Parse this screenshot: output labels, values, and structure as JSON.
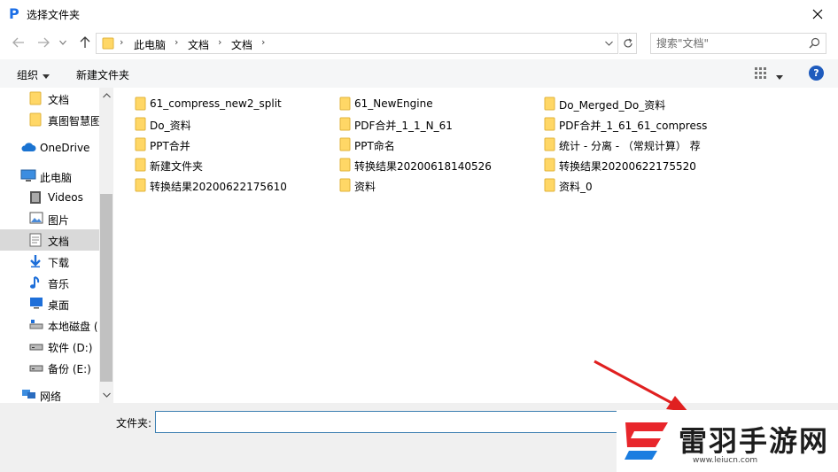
{
  "window": {
    "title": "选择文件夹",
    "app_icon_glyph": "P",
    "accent_color": "#1b6ee6"
  },
  "address_bar": {
    "breadcrumbs": [
      "此电脑",
      "文档",
      "文档"
    ],
    "separator": "›"
  },
  "search": {
    "placeholder": "搜索\"文档\""
  },
  "toolbar": {
    "organize_label": "组织",
    "new_folder_label": "新建文件夹",
    "help_label": "?"
  },
  "nav": {
    "items": [
      {
        "label": "文档",
        "icon": "folder-icon"
      },
      {
        "label": "真图智慧图",
        "icon": "folder-icon"
      },
      {
        "label": "OneDrive",
        "icon": "cloud-icon"
      },
      {
        "label": "此电脑",
        "icon": "computer-icon"
      },
      {
        "label": "Videos",
        "icon": "video-icon"
      },
      {
        "label": "图片",
        "icon": "pictures-icon"
      },
      {
        "label": "文档",
        "icon": "documents-icon"
      },
      {
        "label": "下载",
        "icon": "download-icon"
      },
      {
        "label": "音乐",
        "icon": "music-icon"
      },
      {
        "label": "桌面",
        "icon": "desktop-icon"
      },
      {
        "label": "本地磁盘 (",
        "icon": "drive-icon"
      },
      {
        "label": "软件 (D:)",
        "icon": "drive-icon"
      },
      {
        "label": "备份 (E:)",
        "icon": "drive-icon"
      },
      {
        "label": "网络",
        "icon": "network-icon"
      }
    ],
    "selected_index": 6
  },
  "files": [
    "61_compress_new2_split",
    "Do_资料",
    "PPT合并",
    "新建文件夹",
    "转换结果20200622175610",
    "61_NewEngine",
    "PDF合并_1_1_N_61",
    "PPT命名",
    "转换结果20200618140526",
    "资料",
    "Do_Merged_Do_资料",
    "PDF合并_1_61_61_compress",
    "统计 - 分离 - （常规计算） 荐",
    "转换结果20200622175520",
    "资料_0"
  ],
  "bottom": {
    "folder_label": "文件夹:",
    "folder_value": ""
  },
  "watermark": {
    "title": "雷羽手游网",
    "url": "www.leiucn.com",
    "logo_color": "#e8262b"
  }
}
